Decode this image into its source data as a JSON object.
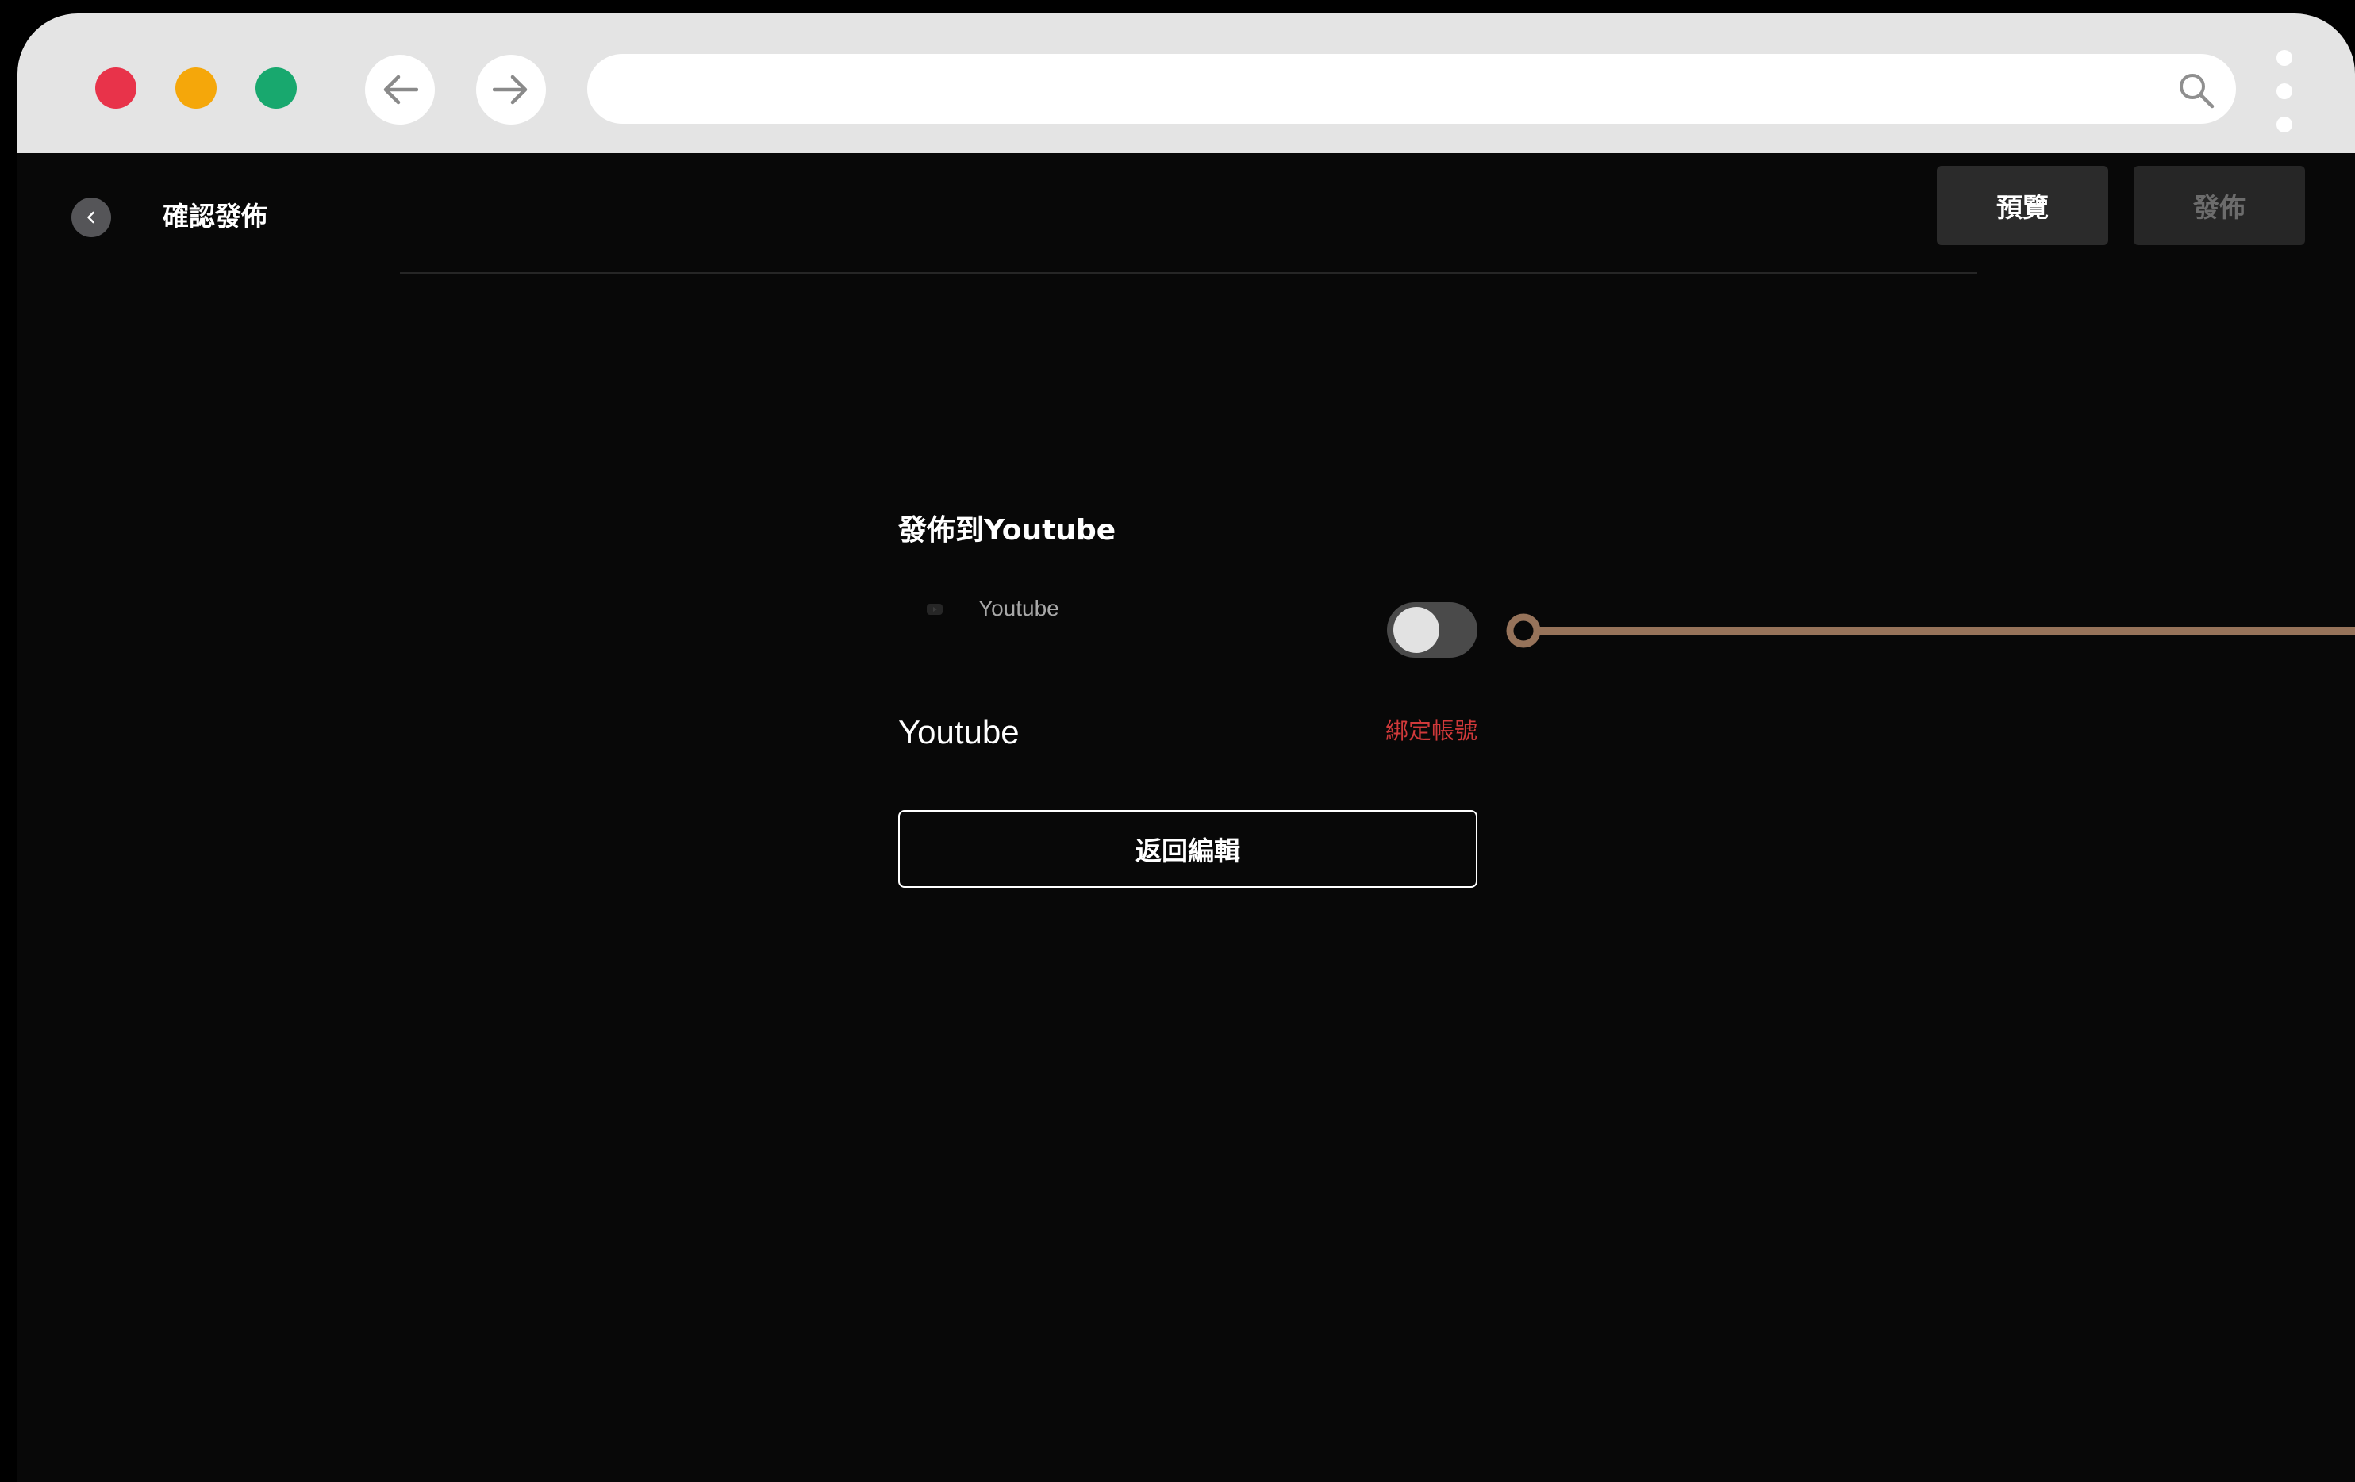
{
  "browser": {
    "traffic_lights": {
      "close_color": "#e8334a",
      "minimize_color": "#f5a70a",
      "zoom_color": "#18a86e"
    },
    "back_icon": "arrow-left-icon",
    "forward_icon": "arrow-right-icon",
    "address_value": "",
    "search_icon": "magnifier-icon",
    "menu_icon": "kebab-vertical-icon"
  },
  "header": {
    "back_icon": "chevron-left-icon",
    "title": "確認發佈",
    "preview_label": "預覽",
    "publish_label": "發佈"
  },
  "main": {
    "section_title": "發佈到Youtube",
    "platform_icon": "youtube-icon",
    "platform_name": "Youtube",
    "toggle_state": "off",
    "account_label": "Youtube",
    "bind_account_label": "綁定帳號",
    "back_to_edit_label": "返回編輯"
  },
  "colors": {
    "background": "#080808",
    "chrome": "#e4e4e4",
    "accent_red": "#d0393a",
    "callout": "#96735a"
  }
}
